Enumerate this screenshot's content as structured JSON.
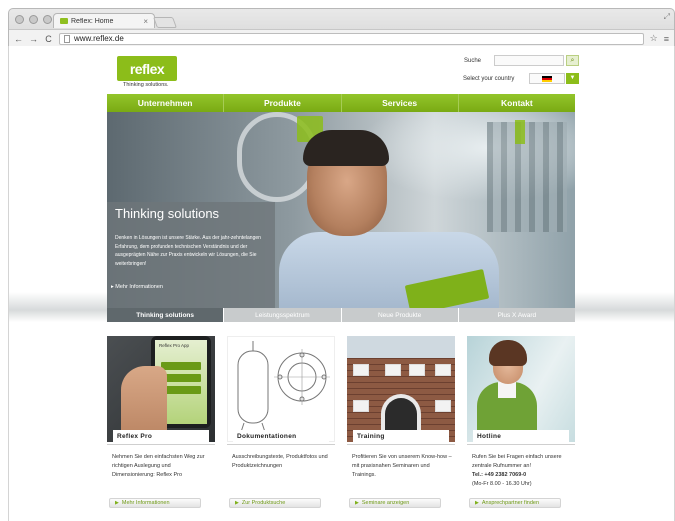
{
  "browser": {
    "tab_title": "Reflex: Home",
    "tab_close": "×",
    "url": "www.reflex.de",
    "nav": {
      "back": "←",
      "forward": "→",
      "reload": "C"
    },
    "star": "☆",
    "menu": "≡"
  },
  "header": {
    "logo_text": "reflex",
    "tagline": "Thinking solutions.",
    "search_label": "Suche",
    "search_placeholder": "",
    "country_label": "Select your country"
  },
  "main_nav": [
    "Unternehmen",
    "Produkte",
    "Services",
    "Kontakt"
  ],
  "hero": {
    "title": "Thinking solutions",
    "text": "Denken in Lösungen ist unsere Stärke. Aus der jahr-zehntelangen Erfahrung, dem profunden technischen Verständnis und der ausgeprägten Nähe zur Praxis entwickeln wir Lösungen, die Sie weiterbringen!",
    "more": "Mehr Informationen"
  },
  "hero_tabs": [
    {
      "label": "Thinking solutions",
      "active": true
    },
    {
      "label": "Leistungsspektrum",
      "active": false
    },
    {
      "label": "Neue Produkte",
      "active": false
    },
    {
      "label": "Plus X Award",
      "active": false
    }
  ],
  "cards": [
    {
      "title": "Reflex Pro",
      "desc": "Nehmen Sie den einfachsten Weg zur richtigen Auslegung und Dimensionierung: Reflex Pro",
      "button": "Mehr Informationen",
      "phone_label": "Reflex Pro App"
    },
    {
      "title": "Dokumentationen",
      "desc": "Ausschreibungstexte, Produktfotos und Produktzeichnungen",
      "button": "Zur Produktsuche"
    },
    {
      "title": "Training",
      "desc": "Profitieren Sie von unserem Know-how – mit praxisnahen Seminaren und Trainings.",
      "button": "Seminare anzeigen"
    },
    {
      "title": "Hotline",
      "desc": "Rufen Sie bei Fragen einfach unsere zentrale Rufnummer an!",
      "phone": "Tel.: +49 2382 7069-0",
      "hours": "(Mo-Fr 8.00 - 16.30 Uhr)",
      "button": "Ansprechpartner finden"
    }
  ],
  "colors": {
    "brand_green": "#8cbd1a",
    "nav_green": "#7fb11a",
    "tab_active": "#5f686c",
    "tab_inactive": "#c8cbcc"
  }
}
